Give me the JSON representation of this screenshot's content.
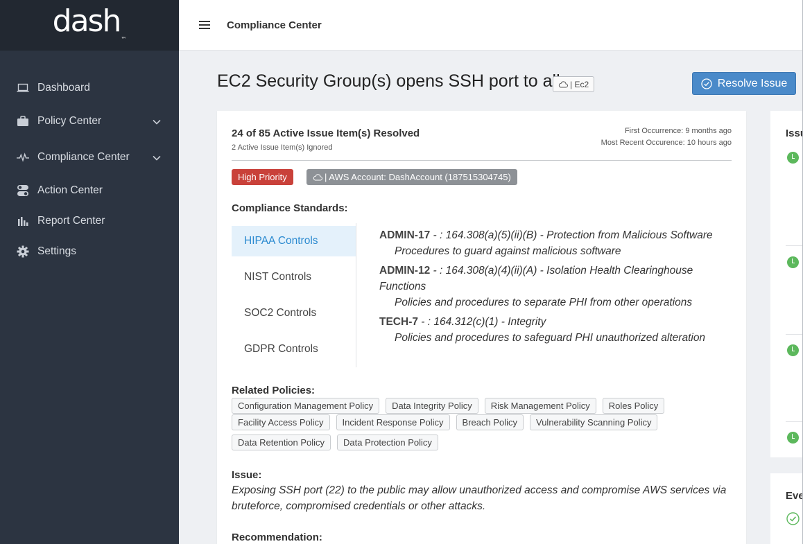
{
  "brand": {
    "name": "dash",
    "tm": "™"
  },
  "sidebar": {
    "items": [
      {
        "label": "Dashboard",
        "icon": "laptop-icon"
      },
      {
        "label": "Policy Center",
        "icon": "briefcase-icon",
        "expandable": true
      },
      {
        "label": "Compliance Center",
        "icon": "pulse-icon",
        "expandable": true
      },
      {
        "label": "Action Center",
        "icon": "toggle-icon"
      },
      {
        "label": "Report Center",
        "icon": "bar-chart-icon"
      },
      {
        "label": "Settings",
        "icon": "gear-icon"
      }
    ]
  },
  "topbar": {
    "title": "Compliance Center"
  },
  "issue": {
    "title": "EC2 Security Group(s) opens SSH port to all",
    "service_chip": "| Ec2",
    "resolve_label": "Resolve Issue",
    "resolved_summary": "24 of 85 Active Issue Item(s) Resolved",
    "ignored_summary": "2 Active Issue Item(s) Ignored",
    "first_occurrence": "First Occurrence: 9 months ago",
    "recent_occurrence": "Most Recent Occurence: 10 hours ago",
    "priority": "High Priority",
    "account": "| AWS Account: DashAccount (187515304745)",
    "compliance_label": "Compliance Standards:",
    "standards": [
      "HIPAA Controls",
      "NIST Controls",
      "SOC2 Controls",
      "GDPR Controls"
    ],
    "active_standard": "HIPAA Controls",
    "controls": [
      {
        "code": "ADMIN-17",
        "text": " - : 164.308(a)(5)(ii)(B) - Protection from Malicious Software",
        "desc": "Procedures to guard against malicious software"
      },
      {
        "code": "ADMIN-12",
        "text": " - : 164.308(a)(4)(ii)(A) - Isolation Health Clearinghouse Functions",
        "desc": "Policies and procedures to separate PHI from other operations"
      },
      {
        "code": "TECH-7",
        "text": " - : 164.312(c)(1) - Integrity",
        "desc": "Policies and procedures to safeguard PHI unauthorized alteration"
      }
    ],
    "related_label": "Related Policies:",
    "policies": [
      [
        "Configuration Management Policy",
        "Data Integrity Policy",
        "Risk Management Policy",
        "Roles Policy"
      ],
      [
        "Facility Access Policy",
        "Incident Response Policy",
        "Breach Policy",
        "Vulnerability Scanning Policy"
      ],
      [
        "Data Retention Policy",
        "Data Protection Policy"
      ]
    ],
    "issue_label": "Issue:",
    "issue_text": "Exposing SSH port (22) to the public may allow unauthorized access and compromise AWS services via bruteforce, compromised credentials or other attacks.",
    "recommendation_label": "Recommendation:"
  },
  "side": {
    "top_head": "Issu",
    "bottom_head": "Eve"
  },
  "colors": {
    "sidebar": "#2c3441",
    "brand_bg": "#222831",
    "accent": "#4a8ac9",
    "priority": "#c9413a",
    "success": "#5cb85c"
  }
}
